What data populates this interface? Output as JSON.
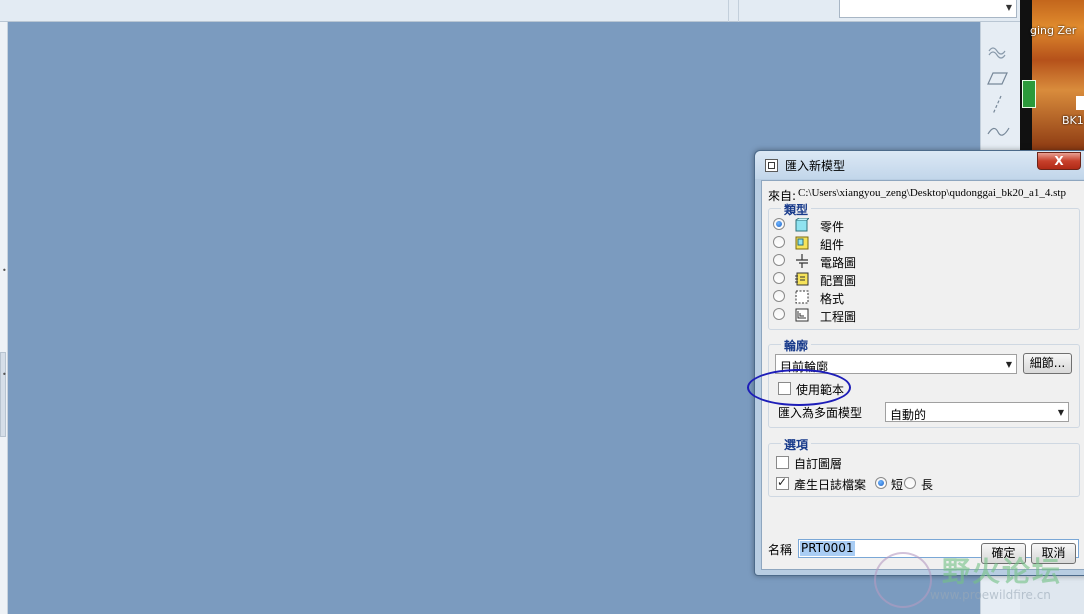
{
  "app": {
    "desktop_label_1": "ging  Zer",
    "desktop_label_2": "BK1"
  },
  "dialog": {
    "title": "匯入新模型",
    "close_label": "X",
    "source_label": "來自:",
    "source_path": "C:\\Users\\xiangyou_zeng\\Desktop\\qudonggai_bk20_a1_4.stp",
    "type_group": {
      "title": "類型",
      "options": [
        {
          "label": "零件",
          "icon": "part-icon",
          "selected": true
        },
        {
          "label": "組件",
          "icon": "assembly-icon",
          "selected": false
        },
        {
          "label": "電路圖",
          "icon": "diagram-icon",
          "selected": false
        },
        {
          "label": "配置圖",
          "icon": "layout-icon",
          "selected": false
        },
        {
          "label": "格式",
          "icon": "format-icon",
          "selected": false
        },
        {
          "label": "工程圖",
          "icon": "drawing-icon",
          "selected": false
        }
      ]
    },
    "profile_group": {
      "title": "輪廓",
      "profile_value": "目前輪廓",
      "details_button": "細節...",
      "use_template_label": "使用範本",
      "use_template_checked": false,
      "import_as_label": "匯入為多面模型",
      "import_as_value": "自動的"
    },
    "options_group": {
      "title": "選項",
      "custom_layers_label": "自訂圖層",
      "custom_layers_checked": false,
      "log_file_label": "產生日誌檔案",
      "log_file_checked": true,
      "log_short_label": "短",
      "log_long_label": "長",
      "log_length_selected": "短"
    },
    "name_label": "名稱",
    "name_value": "PRT0001",
    "ok_button": "確定",
    "cancel_button": "取消"
  },
  "watermark": {
    "text": "野火论坛",
    "url": "www.proewildfire.cn"
  },
  "colors": {
    "viewport_background": "#7b9bbf",
    "annotation_ink": "#1d1db8",
    "group_title": "#1a3c8c"
  }
}
